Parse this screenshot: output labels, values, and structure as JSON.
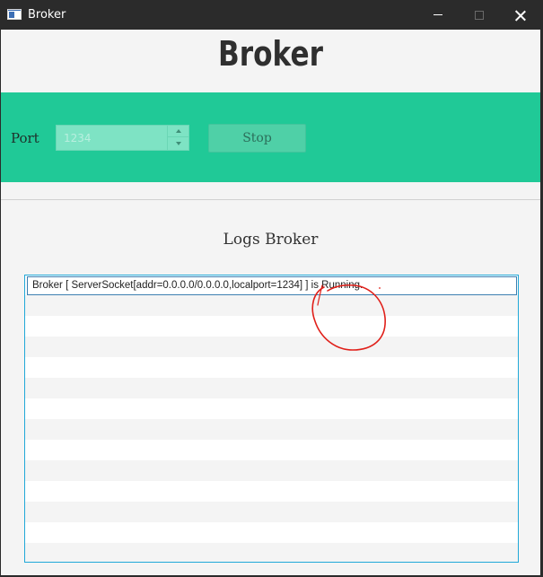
{
  "window": {
    "title": "Broker",
    "icon": "app-window-icon",
    "controls": [
      "minimize-icon",
      "maximize-icon",
      "close-icon"
    ]
  },
  "header": {
    "title": "Broker"
  },
  "controls": {
    "port_label": "Port",
    "port_value": "1234",
    "stop_label": "Stop"
  },
  "logs": {
    "title": "Logs Broker",
    "entries": [
      "Broker [ ServerSocket[addr=0.0.0.0/0.0.0.0,localport=1234] ] is Running."
    ]
  },
  "colors": {
    "accent_band": "#20c997",
    "list_border": "#20a8d8",
    "annotation": "#e0201a"
  }
}
